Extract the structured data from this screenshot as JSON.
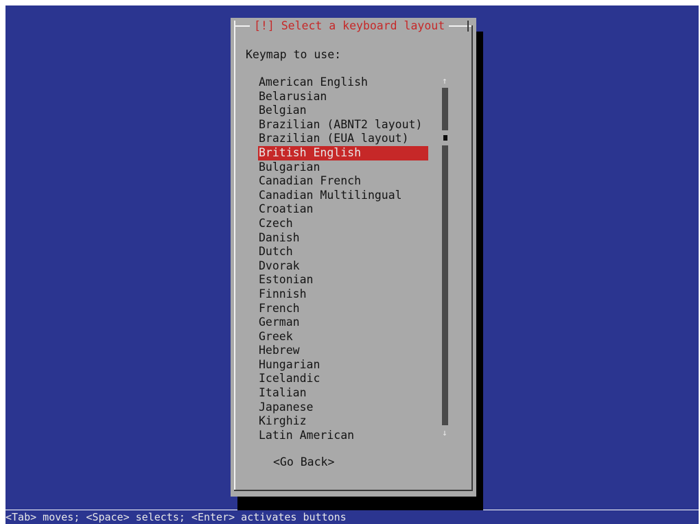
{
  "dialog": {
    "title": "[!] Select a keyboard layout",
    "prompt": "Keymap to use:",
    "selected_index": 5,
    "options": [
      "American English",
      "Belarusian",
      "Belgian",
      "Brazilian (ABNT2 layout)",
      "Brazilian (EUA layout)",
      "British English",
      "Bulgarian",
      "Canadian French",
      "Canadian Multilingual",
      "Croatian",
      "Czech",
      "Danish",
      "Dutch",
      "Dvorak",
      "Estonian",
      "Finnish",
      "French",
      "German",
      "Greek",
      "Hebrew",
      "Hungarian",
      "Icelandic",
      "Italian",
      "Japanese",
      "Kirghiz",
      "Latin American"
    ],
    "scroll_up_glyph": "↑",
    "scroll_down_glyph": "↓",
    "go_back_label": "<Go Back>"
  },
  "status_bar": {
    "hint": "<Tab> moves; <Space> selects; <Enter> activates buttons"
  },
  "colors": {
    "background": "#2b3590",
    "dialog": "#a9a9a9",
    "accent": "#c62828"
  }
}
